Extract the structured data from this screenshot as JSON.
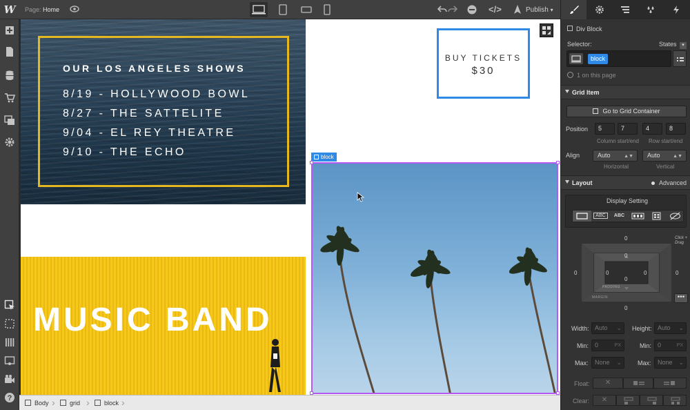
{
  "topbar": {
    "logo": "W",
    "page_prefix": "Page:",
    "page_name": "Home",
    "publish_label": "Publish",
    "icons": [
      "eye-icon",
      "desktop-icon",
      "tablet-icon",
      "phone-landscape-icon",
      "phone-portrait-icon",
      "undo-icon",
      "redo-icon",
      "preview-icon",
      "code-icon",
      "publish-icon"
    ]
  },
  "leftbar": {
    "icons": [
      "add-icon",
      "pages-icon",
      "cms-icon",
      "ecommerce-icon",
      "assets-icon",
      "settings-icon",
      "select-icon",
      "outline-icon",
      "xray-icon",
      "preview-mode-icon",
      "video-icon",
      "help-icon"
    ]
  },
  "canvas": {
    "shows_title": "OUR LOS ANGELES SHOWS",
    "shows": [
      "8/19 - HOLLYWOOD BOWL",
      "8/27 - THE SATTELITE",
      "9/04 - EL REY THEATRE",
      "9/10 - THE ECHO"
    ],
    "tickets_label": "BUY TICKETS",
    "tickets_price": "$30",
    "band_title": "MUSIC BAND",
    "selected_tag": "block"
  },
  "breadcrumb": [
    "Body",
    "grid",
    "block"
  ],
  "panel": {
    "element_type": "Div Block",
    "selector_label": "Selector:",
    "states_label": "States",
    "selector_class": "block",
    "on_page_text": "1 on this page",
    "grid_item": {
      "title": "Grid Item",
      "go_to_container": "Go to Grid Container",
      "position_label": "Position",
      "column_start": "5",
      "column_end": "7",
      "row_start": "4",
      "row_end": "8",
      "column_caption": "Column start/end",
      "row_caption": "Row start/end",
      "align_label": "Align",
      "align_h": "Auto",
      "align_v": "Auto",
      "horizontal_caption": "Horizontal",
      "vertical_caption": "Vertical"
    },
    "layout": {
      "title": "Layout",
      "advanced_label": "Advanced",
      "display_label": "Display Setting",
      "display_options": [
        "block",
        "inline-block",
        "inline",
        "flex",
        "grid",
        "none"
      ],
      "display_option_labels": [
        "",
        "ABC",
        "ABC",
        "",
        "",
        ""
      ],
      "margin_top": "0",
      "margin_left": "0",
      "margin_right": "0",
      "margin_bottom": "0",
      "padding_top": "0",
      "padding_left": "0",
      "padding_right": "0",
      "padding_bottom": "0",
      "margin_caption": "MARGIN",
      "padding_caption": "PADDING",
      "drag_hint": "Click + Drag"
    },
    "size": {
      "width_label": "Width:",
      "width_value": "Auto",
      "height_label": "Height:",
      "height_value": "Auto",
      "min_label": "Min:",
      "min_w": "0",
      "min_h": "0",
      "unit": "PX",
      "max_label": "Max:",
      "max_w": "None",
      "max_h": "None"
    },
    "float_label": "Float:",
    "clear_label": "Clear:"
  }
}
